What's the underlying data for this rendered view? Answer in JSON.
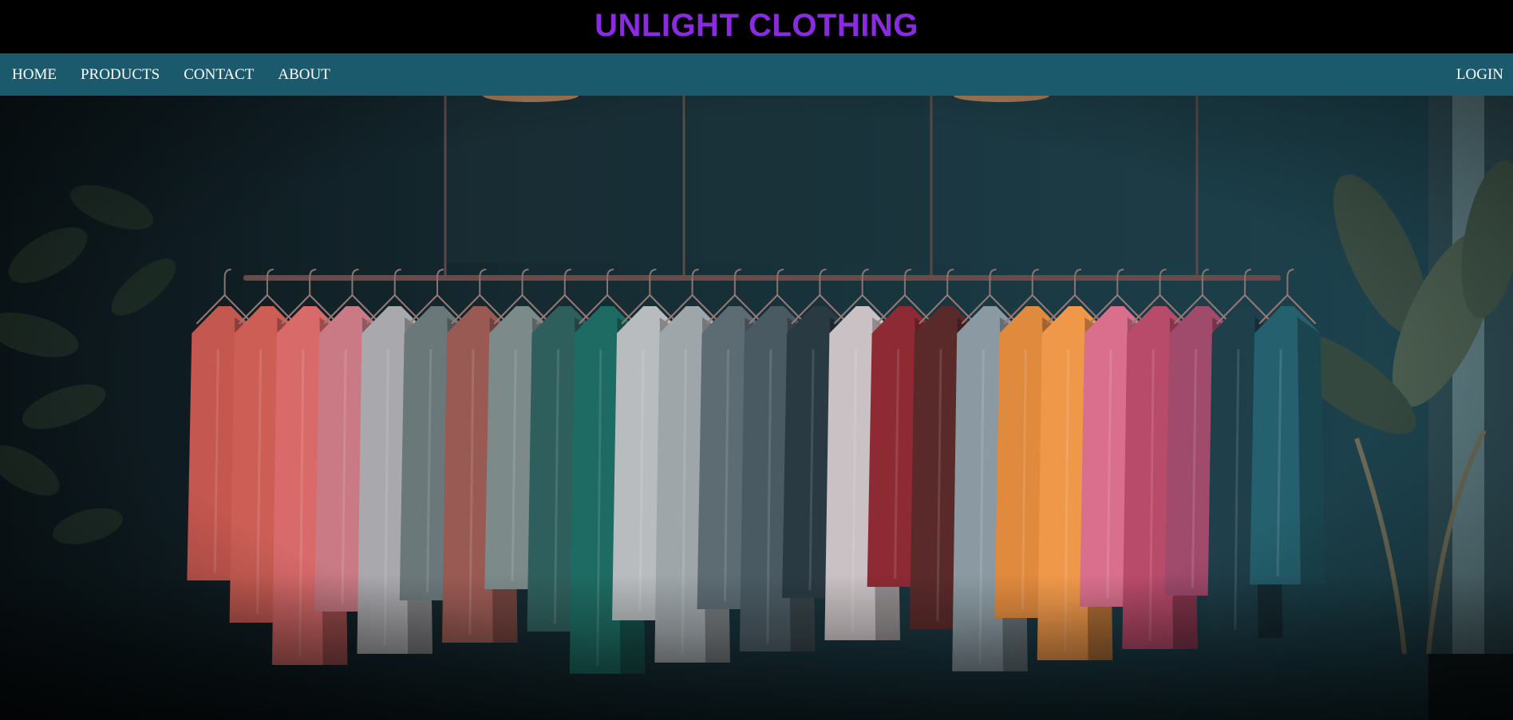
{
  "header": {
    "brand": "UNLIGHT CLOTHING",
    "brand_color": "#8a2be2",
    "background": "#000000"
  },
  "nav": {
    "background": "#1b5a6c",
    "items": [
      {
        "label": "HOME"
      },
      {
        "label": "PRODUCTS"
      },
      {
        "label": "CONTACT"
      },
      {
        "label": "ABOUT"
      }
    ],
    "login_label": "LOGIN"
  },
  "hero": {
    "image": "clothing-rack-photo",
    "garment_colors": [
      "#c4574f",
      "#cc5e55",
      "#d86a6a",
      "#c97a84",
      "#a9a9ad",
      "#6b7879",
      "#9a5a54",
      "#7d8a8a",
      "#2f5f5c",
      "#1d6b62",
      "#b8bcbe",
      "#9fa6aa",
      "#5d6b73",
      "#4a5a62",
      "#2a3a42",
      "#c9c1c3",
      "#8e2a34",
      "#5a2a2a",
      "#8b9aa2",
      "#e08a3e",
      "#f0984a",
      "#d96f8c",
      "#b84a6a",
      "#a04a6c",
      "#1f3f4a",
      "#25606e"
    ]
  }
}
